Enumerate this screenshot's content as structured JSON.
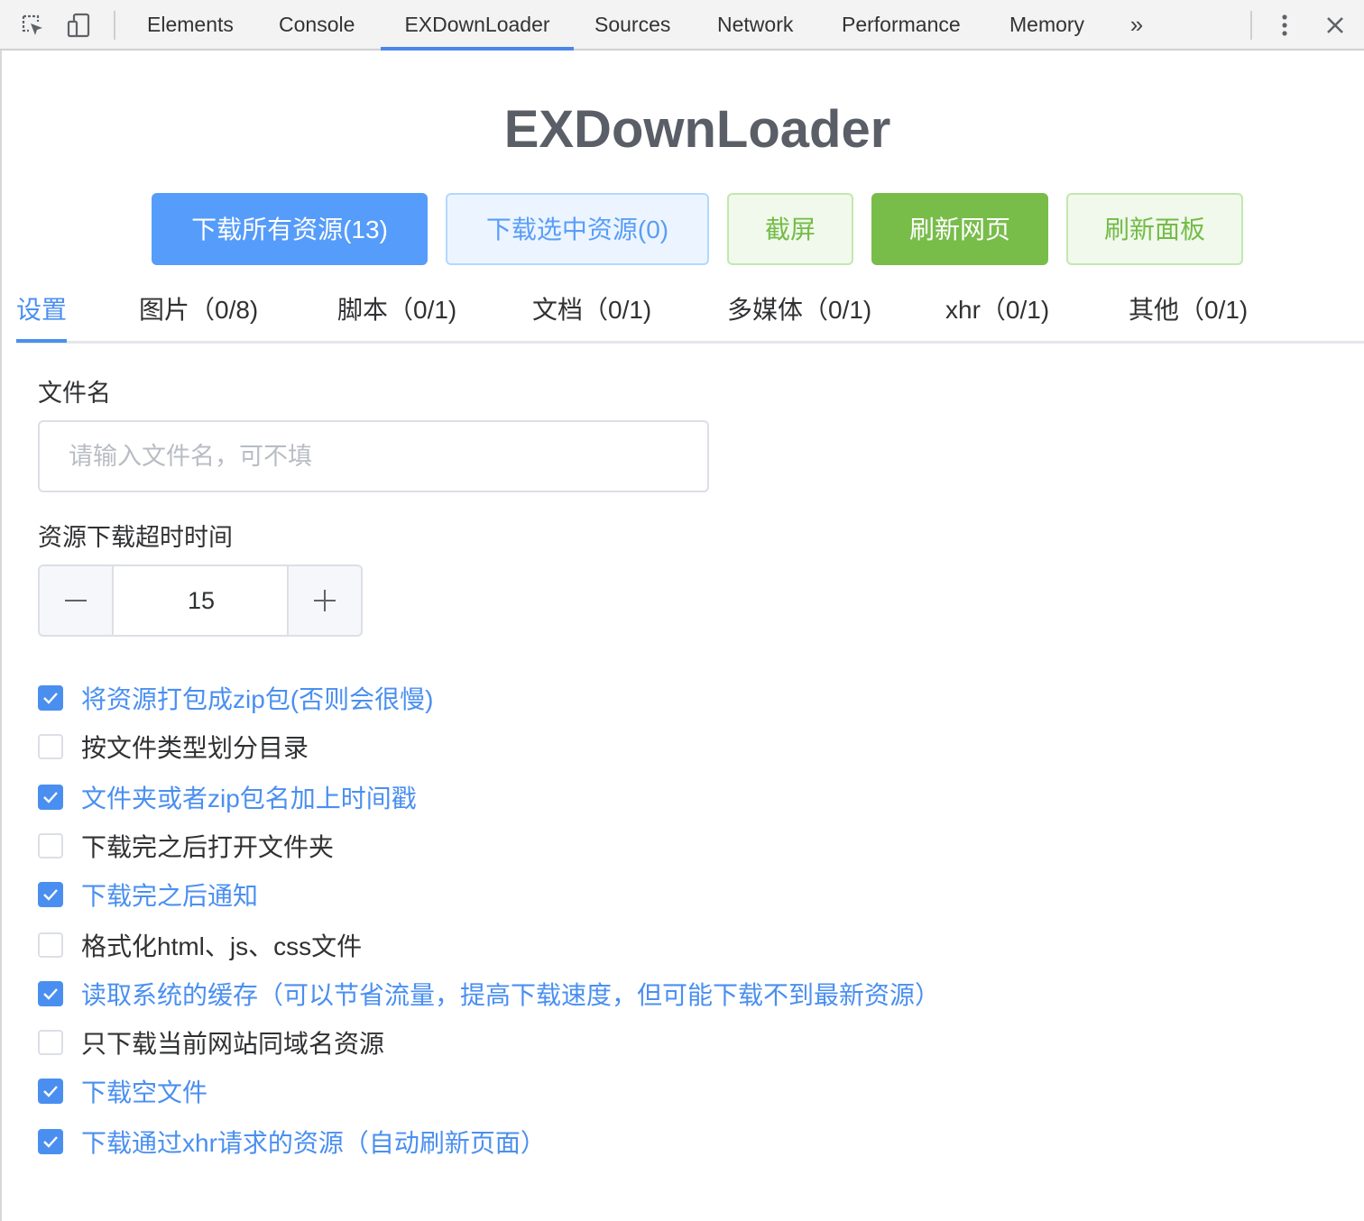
{
  "devtools": {
    "tabs": [
      {
        "label": "Elements"
      },
      {
        "label": "Console"
      },
      {
        "label": "EXDownLoader",
        "active": true
      },
      {
        "label": "Sources"
      },
      {
        "label": "Network"
      },
      {
        "label": "Performance"
      },
      {
        "label": "Memory"
      }
    ],
    "more_tabs_glyph": "»",
    "accent_color": "#4a86e8"
  },
  "app": {
    "title": "EXDownLoader",
    "buttons": {
      "download_all": "下载所有资源(13)",
      "download_selected": "下载选中资源(0)",
      "screenshot": "截屏",
      "refresh_page": "刷新网页",
      "refresh_panel": "刷新面板"
    },
    "tabs": [
      {
        "label": "设置",
        "active": true
      },
      {
        "label": "图片（0/8)"
      },
      {
        "label": "脚本（0/1)"
      },
      {
        "label": "文档（0/1)"
      },
      {
        "label": "多媒体（0/1)"
      },
      {
        "label": "xhr（0/1)"
      },
      {
        "label": "其他（0/1)"
      }
    ],
    "settings": {
      "filename_label": "文件名",
      "filename_value": "",
      "filename_placeholder": "请输入文件名，可不填",
      "timeout_label": "资源下载超时时间",
      "timeout_value": "15",
      "options": [
        {
          "label": "将资源打包成zip包(否则会很慢)",
          "checked": true
        },
        {
          "label": "按文件类型划分目录",
          "checked": false
        },
        {
          "label": "文件夹或者zip包名加上时间戳",
          "checked": true
        },
        {
          "label": "下载完之后打开文件夹",
          "checked": false
        },
        {
          "label": "下载完之后通知",
          "checked": true
        },
        {
          "label": "格式化html、js、css文件",
          "checked": false
        },
        {
          "label": "读取系统的缓存（可以节省流量，提高下载速度，但可能下载不到最新资源）",
          "checked": true
        },
        {
          "label": "只下载当前网站同域名资源",
          "checked": false
        },
        {
          "label": "下载空文件",
          "checked": true
        },
        {
          "label": "下载通过xhr请求的资源（自动刷新页面）",
          "checked": true
        }
      ]
    },
    "colors": {
      "primary": "#4a8ff0",
      "success": "#78bd4a"
    }
  }
}
